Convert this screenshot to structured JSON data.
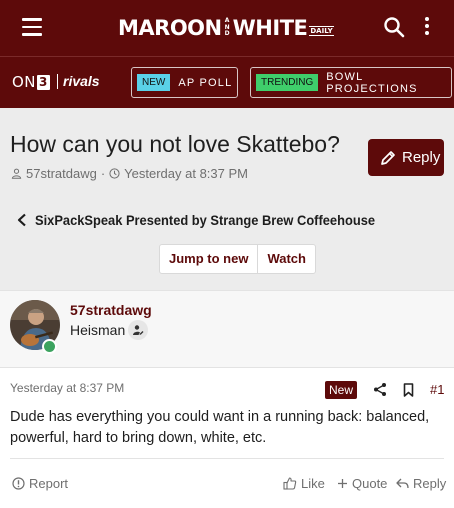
{
  "header": {
    "brand_left": "MAROON",
    "brand_and": [
      "A",
      "N",
      "D"
    ],
    "brand_right": "WHITE",
    "brand_daily": "DAILY",
    "on3_label": "ON",
    "on3_number": "3",
    "rivals_label": "rivals",
    "pills": [
      {
        "tag": "NEW",
        "text": "AP POLL",
        "tag_color": "#5ad1e8"
      },
      {
        "tag": "TRENDING",
        "text": "BOWL PROJECTIONS",
        "tag_color": "#3fce6b"
      }
    ],
    "colors": {
      "brand": "#5d0a0a"
    }
  },
  "thread": {
    "title": "How can you not love Skattebo?",
    "reply_label": "Reply",
    "author": "57stratdawg",
    "separator": "·",
    "date": "Yesterday at 8:37 PM",
    "forum": "SixPackSpeak Presented by Strange Brew Coffeehouse",
    "jump_label": "Jump to new",
    "watch_label": "Watch"
  },
  "post": {
    "username": "57stratdawg",
    "user_title": "Heisman",
    "date": "Yesterday at 8:37 PM",
    "new_label": "New",
    "number": "#1",
    "body": "Dude has everything you could want in a running back: balanced, powerful, hard to bring down, white, etc.",
    "actions": {
      "report": "Report",
      "like": "Like",
      "quote": "Quote",
      "reply": "Reply"
    }
  }
}
